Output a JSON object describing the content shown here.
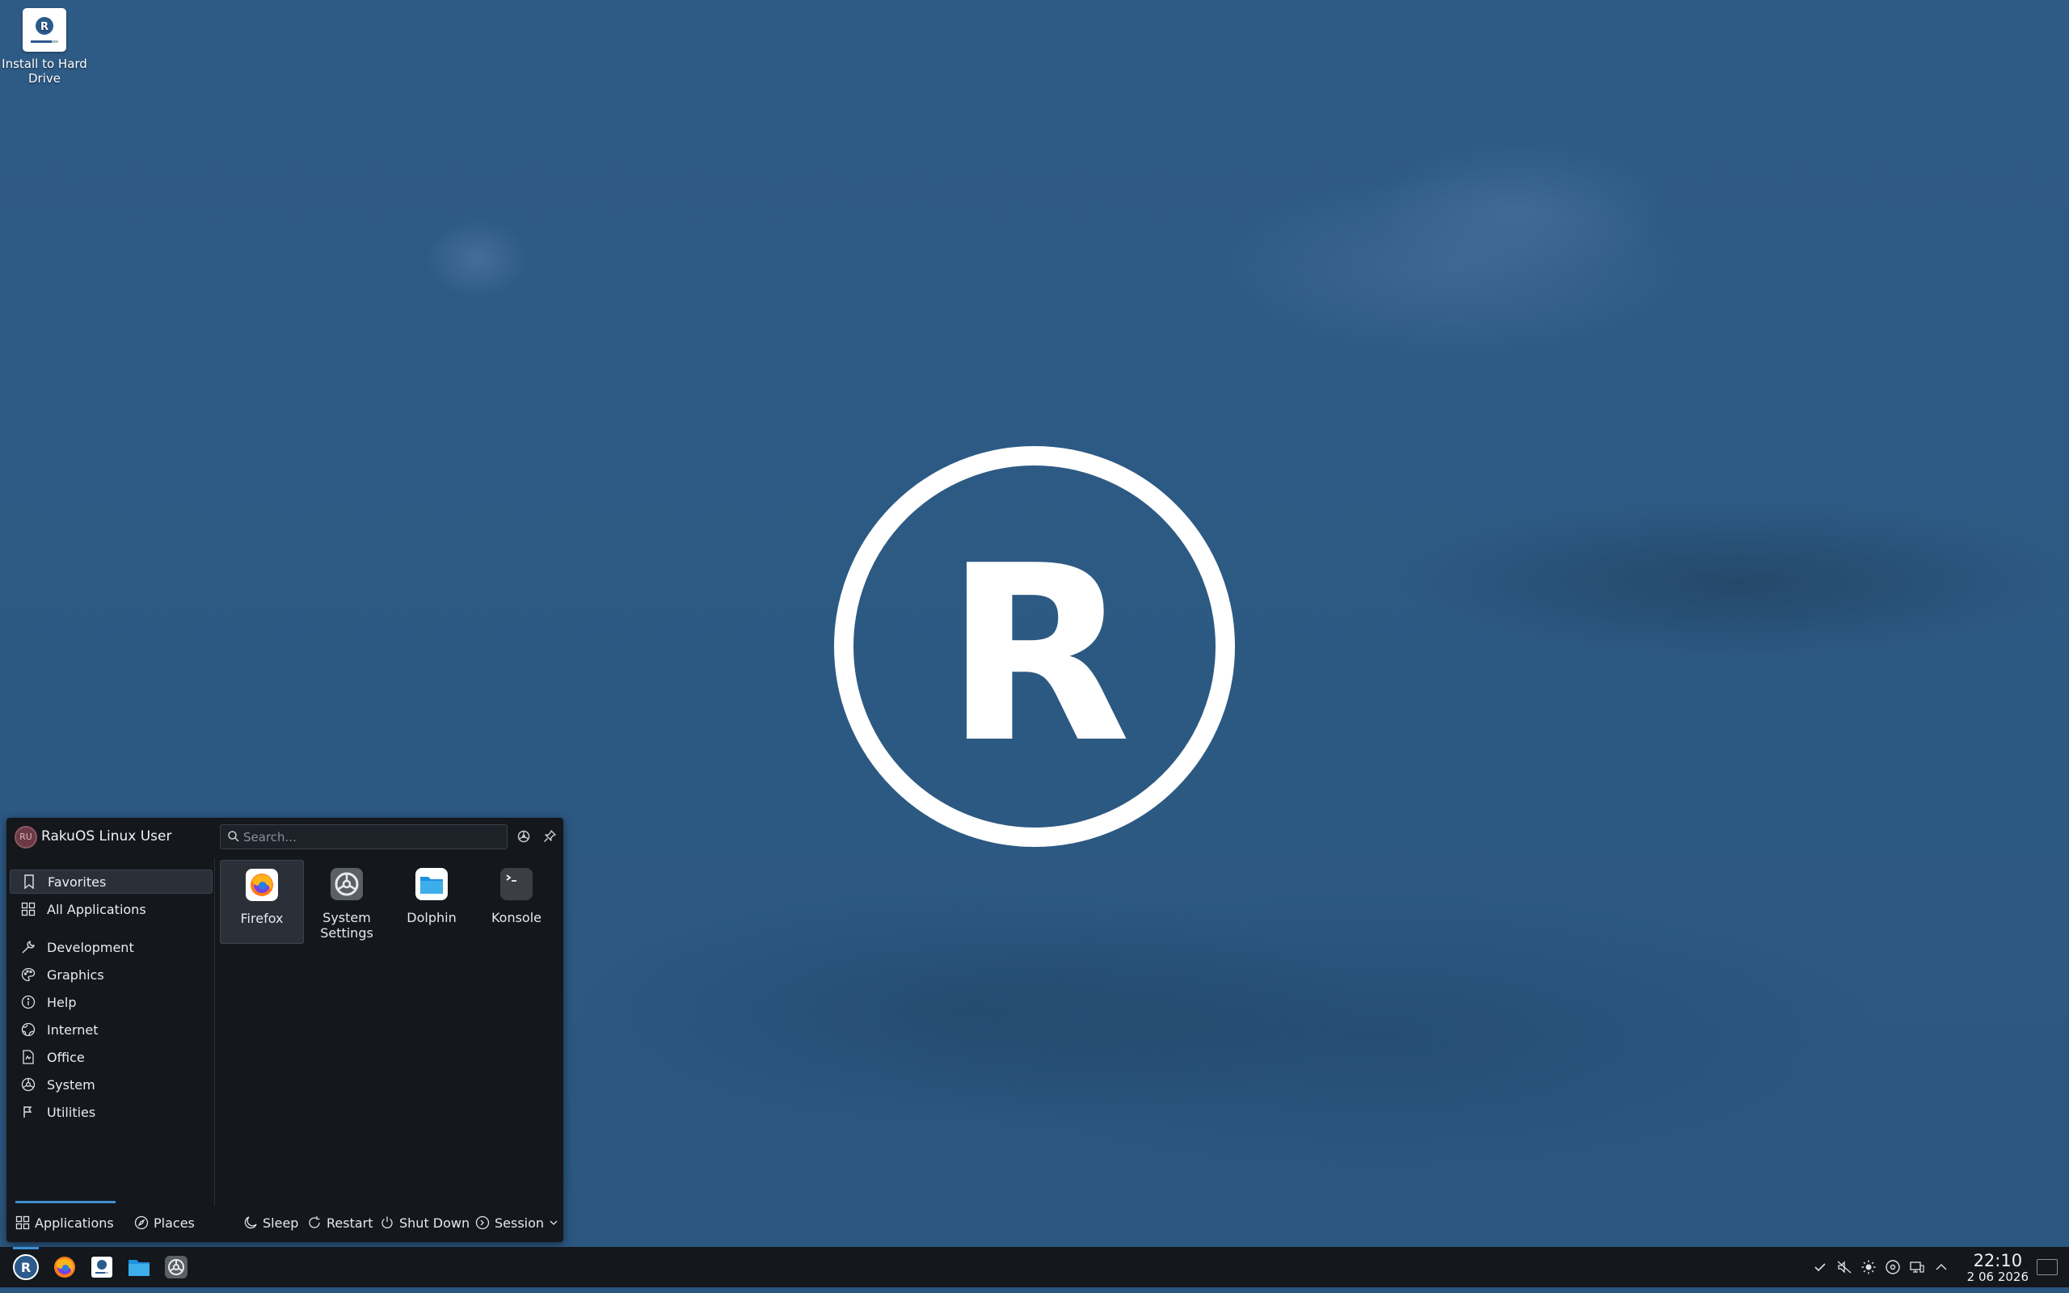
{
  "desktop": {
    "icons": [
      {
        "label": "Install to Hard Drive",
        "icon": "rakuos-installer-icon"
      }
    ],
    "wallpaper_logo_letter": "R"
  },
  "launcher": {
    "user_name": "RakuOS Linux User",
    "user_initials": "RU",
    "search_placeholder": "Search...",
    "sidebar": [
      {
        "label": "Favorites",
        "icon": "bookmark-icon",
        "active": true
      },
      {
        "label": "All Applications",
        "icon": "grid-icon"
      },
      {
        "label": "Development",
        "icon": "wrench-icon"
      },
      {
        "label": "Graphics",
        "icon": "palette-icon"
      },
      {
        "label": "Help",
        "icon": "info-icon"
      },
      {
        "label": "Internet",
        "icon": "globe-icon"
      },
      {
        "label": "Office",
        "icon": "document-icon"
      },
      {
        "label": "System",
        "icon": "settings-icon"
      },
      {
        "label": "Utilities",
        "icon": "tools-icon"
      }
    ],
    "favorites": [
      {
        "label": "Firefox",
        "icon": "firefox-icon"
      },
      {
        "label": "System Settings",
        "icon": "system-settings-icon"
      },
      {
        "label": "Dolphin",
        "icon": "folder-icon"
      },
      {
        "label": "Konsole",
        "icon": "terminal-icon"
      }
    ],
    "footer": {
      "tab_applications": "Applications",
      "tab_places": "Places",
      "sleep": "Sleep",
      "restart": "Restart",
      "shutdown": "Shut Down",
      "session": "Session"
    }
  },
  "taskbar": {
    "apps": [
      "start-menu-icon",
      "firefox-icon",
      "installer-icon",
      "dolphin-icon",
      "system-settings-icon"
    ],
    "tray": [
      "check-icon",
      "volume-muted-icon",
      "brightness-icon",
      "disc-icon",
      "network-icon",
      "chevron-up-icon"
    ],
    "time": "22:10",
    "date": "2 06 2026"
  },
  "colors": {
    "wallpaper": "#2d5a85",
    "panel": "#14171c",
    "accent": "#3d8fd4"
  }
}
